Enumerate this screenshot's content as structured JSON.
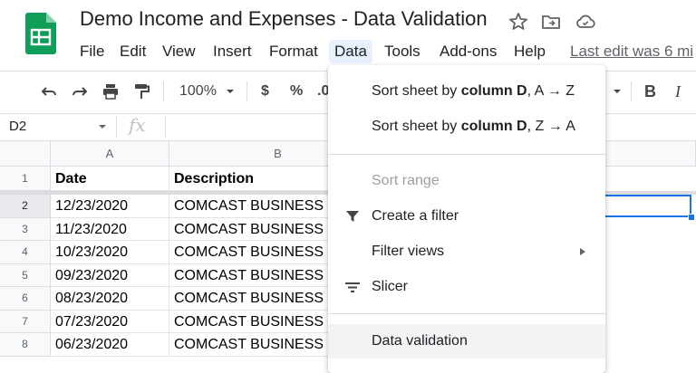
{
  "title": "Demo Income and Expenses - Data Validation",
  "menubar": [
    "File",
    "Edit",
    "View",
    "Insert",
    "Format",
    "Data",
    "Tools",
    "Add-ons",
    "Help"
  ],
  "last_edit": "Last edit was 6 mi",
  "toolbar": {
    "zoom": "100%",
    "currency": "$",
    "percent": "%",
    "decimal": ".0",
    "bold": "B",
    "italic": "I"
  },
  "namebox": "D2",
  "fx": "fx",
  "columns": [
    "A",
    "B"
  ],
  "header_row": {
    "num": "1",
    "a": "Date",
    "b": "Description"
  },
  "rows": [
    {
      "num": "2",
      "date": "12/23/2020",
      "desc": "COMCAST BUSINESS"
    },
    {
      "num": "3",
      "date": "11/23/2020",
      "desc": "COMCAST BUSINESS"
    },
    {
      "num": "4",
      "date": "10/23/2020",
      "desc": "COMCAST BUSINESS"
    },
    {
      "num": "5",
      "date": "09/23/2020",
      "desc": "COMCAST BUSINESS"
    },
    {
      "num": "6",
      "date": "08/23/2020",
      "desc": "COMCAST BUSINESS"
    },
    {
      "num": "7",
      "date": "07/23/2020",
      "desc": "COMCAST BUSINESS"
    },
    {
      "num": "8",
      "date": "06/23/2020",
      "desc": "COMCAST BUSINESS"
    }
  ],
  "data_menu": {
    "sort_az": {
      "pre": "Sort sheet by ",
      "bold": "column D",
      "post": ", A → Z"
    },
    "sort_za": {
      "pre": "Sort sheet by ",
      "bold": "column D",
      "post": ", Z → A"
    },
    "sort_range": "Sort range",
    "create_filter": "Create a filter",
    "filter_views": "Filter views",
    "slicer": "Slicer",
    "data_validation": "Data validation"
  },
  "colors": {
    "brand": "#0f9d58",
    "selection": "#1a73e8",
    "menu_active": "#e8f0fe"
  }
}
